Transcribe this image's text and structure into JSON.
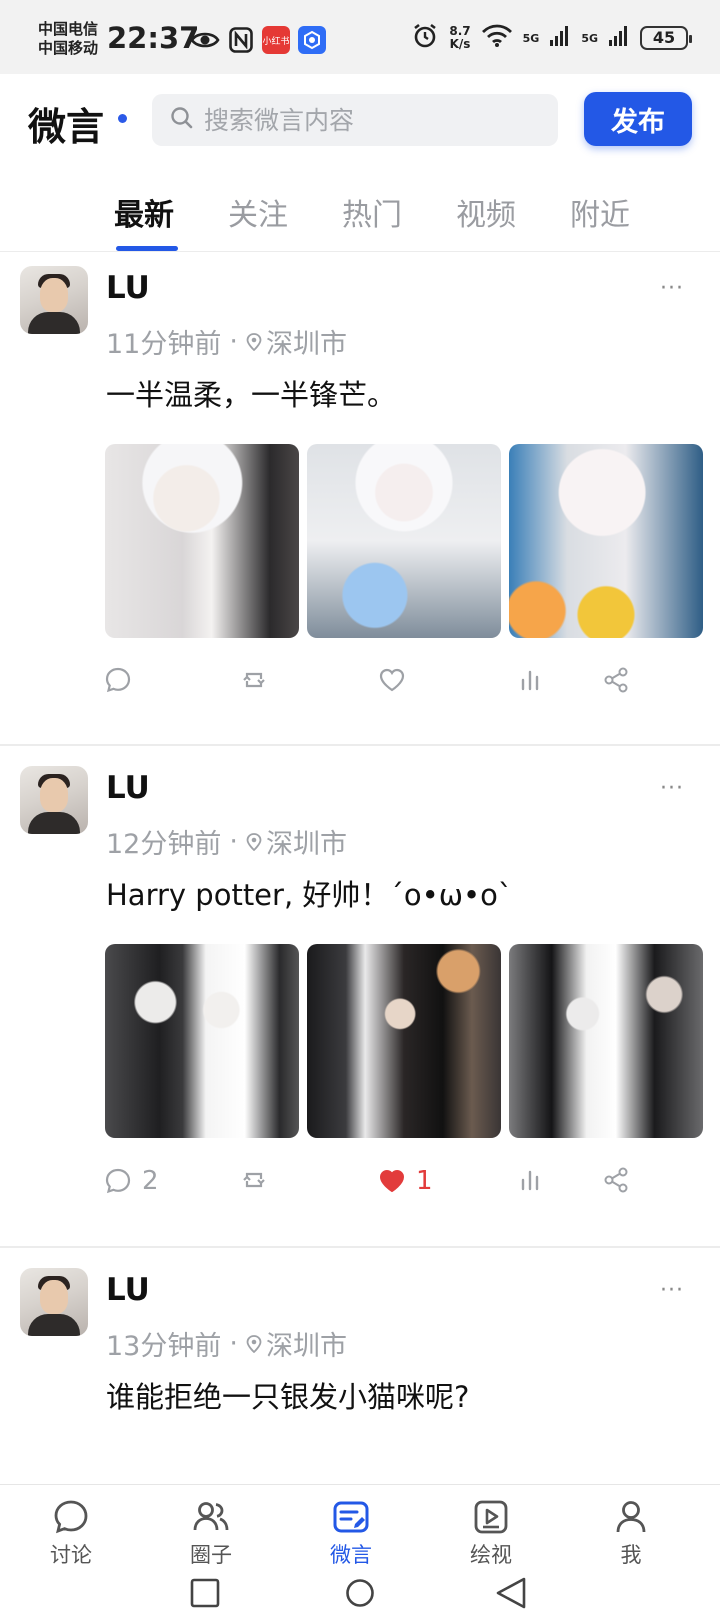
{
  "status_bar": {
    "carrier_1": "中国电信",
    "carrier_2": "中国移动",
    "time": "22:37",
    "speed_value": "8.7",
    "speed_unit": "K/s",
    "signal_1": "5G",
    "signal_2": "5G",
    "battery": "45",
    "badge_red_text": "小红书"
  },
  "header": {
    "title": "微言",
    "search_placeholder": "搜索微言内容",
    "publish_label": "发布",
    "accent_color": "#2358e6"
  },
  "tabs": [
    {
      "label": "最新",
      "active": true
    },
    {
      "label": "关注",
      "active": false
    },
    {
      "label": "热门",
      "active": false
    },
    {
      "label": "视频",
      "active": false
    },
    {
      "label": "附近",
      "active": false
    }
  ],
  "posts": [
    {
      "username": "LU",
      "time": "11分钟前",
      "separator": "·",
      "location": "深圳市",
      "content": "一半温柔，一半锋芒。",
      "more": "···",
      "comments": "",
      "likes": "",
      "liked": false
    },
    {
      "username": "LU",
      "time": "12分钟前",
      "separator": "·",
      "location": "深圳市",
      "content": "Harry potter, 好帅！´o•ω•o`",
      "more": "···",
      "comments": "2",
      "likes": "1",
      "liked": true
    },
    {
      "username": "LU",
      "time": "13分钟前",
      "separator": "·",
      "location": "深圳市",
      "content": "谁能拒绝一只银发小猫咪呢?",
      "more": "···"
    }
  ],
  "bottom_nav": [
    {
      "label": "讨论",
      "icon": "chat-icon",
      "active": false
    },
    {
      "label": "圈子",
      "icon": "people-icon",
      "active": false
    },
    {
      "label": "微言",
      "icon": "weiyan-icon",
      "active": true
    },
    {
      "label": "绘视",
      "icon": "video-icon",
      "active": false
    },
    {
      "label": "我",
      "icon": "person-icon",
      "active": false
    }
  ],
  "colors": {
    "like_red": "#e23b3b",
    "muted_gray": "#9ea1a6"
  }
}
